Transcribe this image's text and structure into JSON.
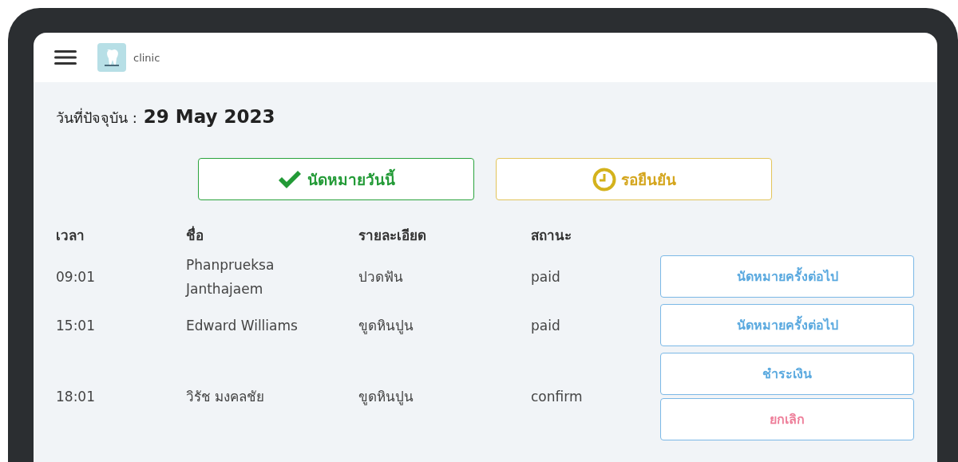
{
  "header": {
    "brand": "clinic"
  },
  "date": {
    "label": "วันที่ปัจจุบัน :",
    "value": "29 May 2023"
  },
  "filters": [
    {
      "kind": "today",
      "label": "นัดหมายวันนี้"
    },
    {
      "kind": "pending",
      "label": "รอยืนยัน"
    }
  ],
  "table": {
    "columns": [
      "เวลา",
      "ชื่อ",
      "รายละเอียด",
      "สถานะ"
    ],
    "rows": [
      {
        "time": "09:01",
        "name": "Phanprueksa Janthajaem",
        "detail": "ปวดฟัน",
        "status": "paid",
        "actions": [
          {
            "kind": "next",
            "label": "นัดหมายครั้งต่อไป"
          }
        ]
      },
      {
        "time": "15:01",
        "name": "Edward Williams",
        "detail": "ขูดหินปูน",
        "status": "paid",
        "actions": [
          {
            "kind": "next",
            "label": "นัดหมายครั้งต่อไป"
          }
        ]
      },
      {
        "time": "18:01",
        "name": "วิรัช มงคลชัย",
        "detail": "ขูดหินปูน",
        "status": "confirm",
        "actions": [
          {
            "kind": "pay",
            "label": "ชำระเงิน"
          },
          {
            "kind": "cancel",
            "label": "ยกเลิก"
          }
        ]
      }
    ]
  }
}
